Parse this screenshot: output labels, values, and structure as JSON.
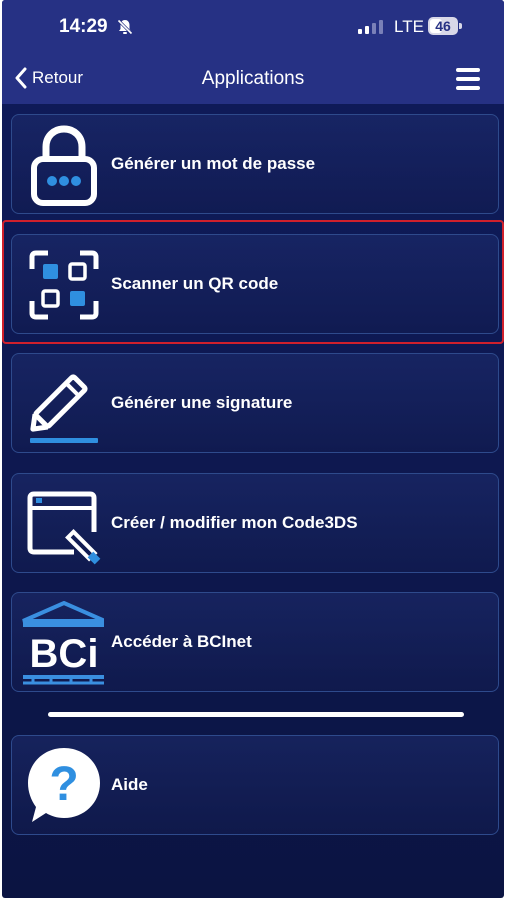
{
  "status_bar": {
    "time": "14:29",
    "network": "LTE",
    "battery_level": "46",
    "battery_fraction": 0.46
  },
  "nav": {
    "back_label": "Retour",
    "title": "Applications"
  },
  "apps": [
    {
      "label": "Générer un mot de passe",
      "icon": "padlock-icon"
    },
    {
      "label": "Scanner un QR code",
      "icon": "qr-scan-icon",
      "highlighted": true
    },
    {
      "label": "Générer une signature",
      "icon": "pencil-icon"
    },
    {
      "label": "Créer / modifier mon Code3DS",
      "icon": "browser-edit-icon"
    },
    {
      "label": "Accéder à BCInet",
      "icon": "bci-logo-icon",
      "logo_text": "BCi"
    },
    {
      "label": "Aide",
      "icon": "help-bubble-icon"
    }
  ],
  "colors": {
    "bar": "#263184",
    "background": "#0f1a5a",
    "accent_blue": "#2f8fe0",
    "highlight": "#d0202c"
  }
}
